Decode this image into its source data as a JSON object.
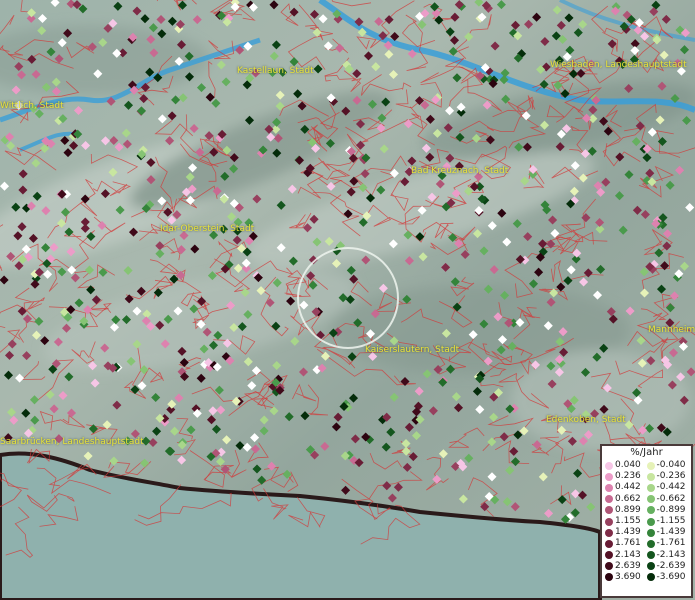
{
  "map": {
    "cities": [
      {
        "name": "Kastellaun, Stadt"
      },
      {
        "name": "Wiesbaden, Landeshauptstadt"
      },
      {
        "name": "Wittlich, Stadt"
      },
      {
        "name": "Bad Kreuznach, Stadt"
      },
      {
        "name": "Idar-Oberstein, Stadt"
      },
      {
        "name": "Mannheim"
      },
      {
        "name": "Kaiserslautern, Stadt"
      },
      {
        "name": "Edenkoben, Stadt"
      },
      {
        "name": "Saarbrücken, Landeshauptstadt"
      }
    ],
    "colors": {
      "border_red": "#d23a3a",
      "river_blue": "#3a9fd8",
      "label_yellow": "#e8e23a",
      "france_area": "#8fb1ad"
    }
  },
  "legend": {
    "title": "%/Jahr",
    "positive": [
      {
        "label": "0.040",
        "color": "#f6c6e6"
      },
      {
        "label": "0.236",
        "color": "#ec9cc8"
      },
      {
        "label": "0.442",
        "color": "#dd82af"
      },
      {
        "label": "0.662",
        "color": "#c86a92"
      },
      {
        "label": "0.899",
        "color": "#b05576"
      },
      {
        "label": "1.155",
        "color": "#97405e"
      },
      {
        "label": "1.439",
        "color": "#7f2c48"
      },
      {
        "label": "1.761",
        "color": "#681c35"
      },
      {
        "label": "2.143",
        "color": "#541226"
      },
      {
        "label": "2.639",
        "color": "#400a1a"
      },
      {
        "label": "3.690",
        "color": "#2c0410"
      }
    ],
    "negative": [
      {
        "label": "-0.040",
        "color": "#e6f2b8"
      },
      {
        "label": "-0.236",
        "color": "#c8e6a0"
      },
      {
        "label": "-0.442",
        "color": "#a8d68a"
      },
      {
        "label": "-0.662",
        "color": "#86c474"
      },
      {
        "label": "-0.899",
        "color": "#66b060"
      },
      {
        "label": "-1.155",
        "color": "#4a9a4c"
      },
      {
        "label": "-1.439",
        "color": "#34843a"
      },
      {
        "label": "-1.761",
        "color": "#226c2a"
      },
      {
        "label": "-2.143",
        "color": "#14561e"
      },
      {
        "label": "-2.639",
        "color": "#0a4214"
      },
      {
        "label": "-3.690",
        "color": "#042c0a"
      }
    ]
  }
}
